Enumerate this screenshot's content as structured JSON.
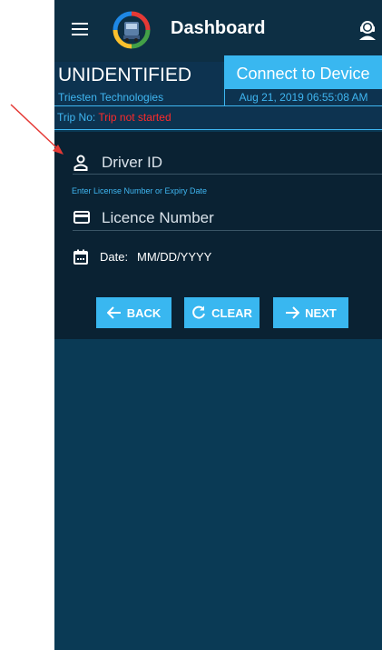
{
  "app": {
    "title": "Dashboard"
  },
  "header": {
    "status": "UNIDENTIFIED",
    "connect_label": "Connect to Device",
    "company": "Triesten Technologies",
    "datetime": "Aug 21, 2019 06:55:08 AM"
  },
  "trip": {
    "label": "Trip No: ",
    "value": "Trip not started"
  },
  "form": {
    "driver_id_placeholder": "Driver ID",
    "hint": "Enter License Number or Expiry Date",
    "licence_placeholder": "Licence Number",
    "date_label": "Date:",
    "date_value": "MM/DD/YYYY"
  },
  "buttons": {
    "back": "BACK",
    "clear": "CLEAR",
    "next": "NEXT"
  },
  "colors": {
    "accent": "#39b7f0",
    "app_bar": "#0d2f44",
    "background": "#0a3a55",
    "error": "#ff2a2a"
  },
  "icons": [
    "menu-icon",
    "app-logo-icon",
    "support-agent-icon",
    "person-icon",
    "card-icon",
    "calendar-icon",
    "arrow-left-icon",
    "refresh-icon",
    "arrow-right-icon"
  ]
}
